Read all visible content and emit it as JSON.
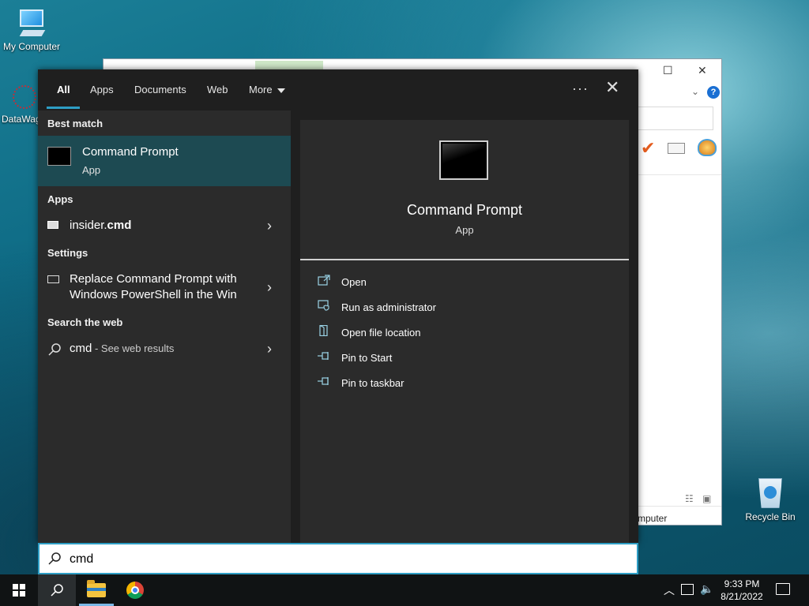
{
  "desktop": {
    "icons": {
      "my_computer": "My Computer",
      "datawag": "DataWag",
      "recycle_bin": "Recycle Bin"
    }
  },
  "background_window": {
    "status_text": "mputer",
    "help_label": "?"
  },
  "search_panel": {
    "tabs": [
      {
        "label": "All",
        "active": true
      },
      {
        "label": "Apps",
        "active": false
      },
      {
        "label": "Documents",
        "active": false
      },
      {
        "label": "Web",
        "active": false
      },
      {
        "label": "More",
        "active": false
      }
    ],
    "more_options_icon": "ellipsis-icon",
    "close_icon": "close-icon",
    "sections": {
      "best_match": "Best match",
      "apps": "Apps",
      "settings": "Settings",
      "search_the_web": "Search the web"
    },
    "best_match": {
      "title": "Command Prompt",
      "subtitle": "App"
    },
    "apps_item": {
      "prefix": "insider.",
      "bold": "cmd"
    },
    "settings_item": {
      "line1": "Replace Command Prompt with",
      "line2": "Windows PowerShell in the Win"
    },
    "web_item": {
      "query": "cmd",
      "hint": " - See web results"
    },
    "detail": {
      "title": "Command Prompt",
      "subtitle": "App",
      "actions": [
        {
          "label": "Open",
          "icon": "open-icon"
        },
        {
          "label": "Run as administrator",
          "icon": "shield-icon"
        },
        {
          "label": "Open file location",
          "icon": "file-location-icon"
        },
        {
          "label": "Pin to Start",
          "icon": "pin-icon"
        },
        {
          "label": "Pin to taskbar",
          "icon": "pin-icon"
        }
      ]
    },
    "search_input": {
      "value": "cmd"
    }
  },
  "taskbar": {
    "clock_time": "9:33 PM",
    "clock_date": "8/21/2022",
    "colors": {
      "accent": "#2e9ec5",
      "selected_row": "#1d4a52",
      "panel_bg": "#2b2b2b"
    }
  }
}
